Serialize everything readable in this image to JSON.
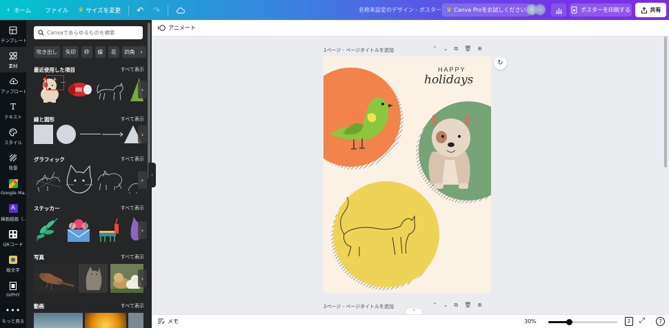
{
  "topbar": {
    "home": "ホーム",
    "file": "ファイル",
    "resize": "サイズを変更",
    "doc_title": "名称未設定のデザイン - ポスター",
    "pro_trial": "Canva Proをお試しください",
    "print": "ポスターを印刷する",
    "share": "共有"
  },
  "rail": [
    {
      "label": "テンプレート",
      "icon": "template-icon"
    },
    {
      "label": "素材",
      "icon": "elements-icon"
    },
    {
      "label": "アップロード",
      "icon": "upload-icon"
    },
    {
      "label": "テキスト",
      "icon": "text-icon"
    },
    {
      "label": "スタイル",
      "icon": "style-icon"
    },
    {
      "label": "背景",
      "icon": "background-icon"
    },
    {
      "label": "Google Ma...",
      "icon": "google-maps-icon"
    },
    {
      "label": "挿画描画（...",
      "icon": "draw-app-icon"
    },
    {
      "label": "QRコード",
      "icon": "qr-code-icon"
    },
    {
      "label": "絵文字",
      "icon": "emoji-icon"
    },
    {
      "label": "GIPHY",
      "icon": "giphy-icon"
    },
    {
      "label": "もっと見る",
      "icon": "more-icon"
    }
  ],
  "panel": {
    "search_placeholder": "Canvaであらゆるものを検索",
    "chips": [
      "吹き出し",
      "矢印",
      "枠",
      "線",
      "花",
      "四角"
    ],
    "see_all": "すべて表示",
    "sections": {
      "recent": "最近使用した項目",
      "lines": "線と図形",
      "graphics": "グラフィック",
      "stickers": "ステッカー",
      "photos": "写真",
      "videos": "動画"
    },
    "more_dots": "..."
  },
  "editor": {
    "animate": "アニメート",
    "page1_label": "1ページ - ページタイトルを追加",
    "page2_label": "2ページ - ページタイトルを追加",
    "card_happy": "HAPPY",
    "card_holidays": "holidays"
  },
  "bottombar": {
    "memo": "メモ",
    "zoom": "30%",
    "zoom_fraction": 0.3,
    "pages": "2"
  },
  "colors": {
    "orange": "#f2834a",
    "green": "#76a477",
    "yellow": "#efd356",
    "card_bg": "#fbf2e5"
  }
}
